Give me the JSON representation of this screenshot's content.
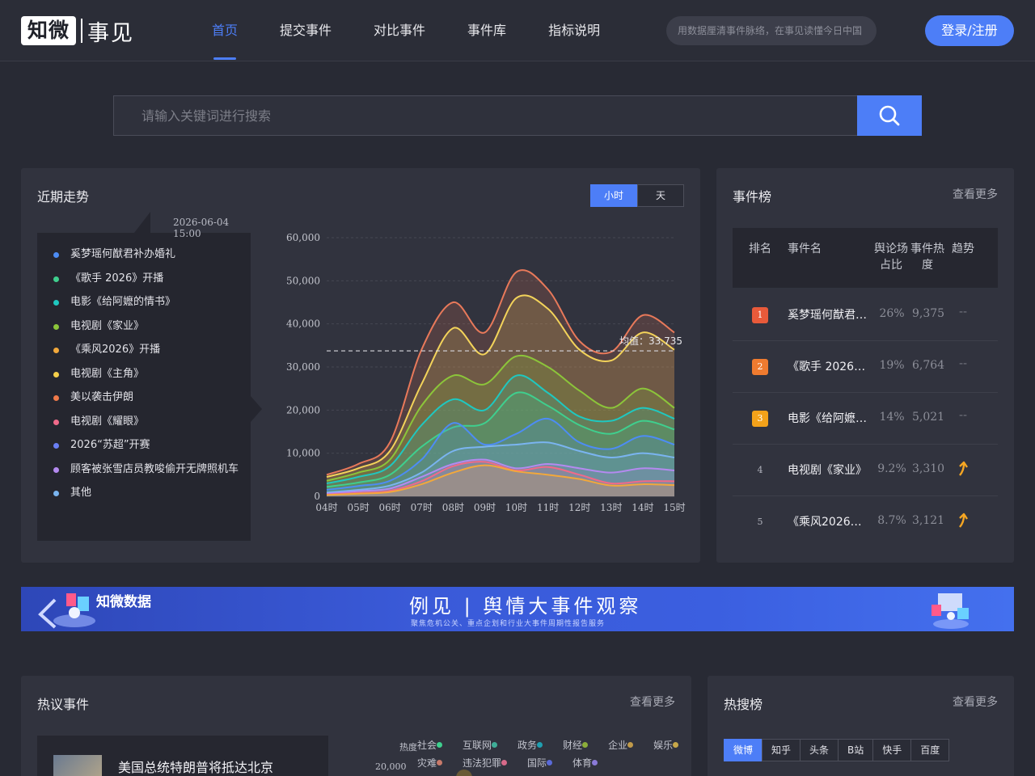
{
  "header": {
    "logo_main": "知微",
    "logo_sub": "事见",
    "nav": [
      "首页",
      "提交事件",
      "对比事件",
      "事件库",
      "指标说明"
    ],
    "search_placeholder": "用数据厘清事件脉络，在事见读懂今日中国",
    "login_label": "登录/注册"
  },
  "search": {
    "placeholder": "请输入关键词进行搜索"
  },
  "trend": {
    "title": "近期走势",
    "toggle": [
      "小时",
      "天"
    ],
    "tooltip_time": "2026-06-04 15:00",
    "tooltip_items": [
      {
        "label": "奚梦瑶何猷君补办婚礼",
        "color": "#4d8cf5"
      },
      {
        "label": "《歌手 2026》开播",
        "color": "#3fcf8e"
      },
      {
        "label": "电影《给阿嬷的情书》",
        "color": "#1fc8c0"
      },
      {
        "label": "电视剧《家业》",
        "color": "#8cc53a"
      },
      {
        "label": "《乘风2026》开播",
        "color": "#f2a83b"
      },
      {
        "label": "电视剧《主角》",
        "color": "#f5cf4a"
      },
      {
        "label": "美以袭击伊朗",
        "color": "#f07a4a"
      },
      {
        "label": "电视剧《耀眼》",
        "color": "#f06a8a"
      },
      {
        "label": "2026“苏超”开赛",
        "color": "#6a7ff5"
      },
      {
        "label": "顾客被张雪店员教唆偷开无牌照机车",
        "color": "#b48af0"
      },
      {
        "label": "其他",
        "color": "#7ab4f0"
      }
    ]
  },
  "chart_data": {
    "type": "area",
    "x": [
      "04时",
      "05时",
      "06时",
      "07时",
      "08时",
      "09时",
      "10时",
      "11时",
      "12时",
      "13时",
      "14时",
      "15时"
    ],
    "yticks": [
      "0",
      "10,000",
      "20,000",
      "30,000",
      "40,000",
      "50,000",
      "60,000"
    ],
    "ylim": [
      0,
      60000
    ],
    "mean_label": "均值：33,735",
    "mean_value": 33735,
    "series": [
      {
        "color": "#e8795a",
        "values": [
          5000,
          7500,
          12500,
          34000,
          45000,
          38000,
          52000,
          48000,
          36000,
          33500,
          42000,
          38000
        ]
      },
      {
        "color": "#f3d35a",
        "values": [
          4500,
          6500,
          10500,
          26000,
          39000,
          33000,
          46000,
          43500,
          34000,
          31500,
          38000,
          34000
        ]
      },
      {
        "color": "#8cc53a",
        "values": [
          3600,
          5500,
          8500,
          21000,
          28000,
          26000,
          32500,
          30000,
          24500,
          20500,
          25000,
          20500
        ]
      },
      {
        "color": "#1fc8c0",
        "values": [
          3000,
          4500,
          7000,
          16500,
          22500,
          20000,
          28000,
          24000,
          18500,
          17500,
          20500,
          18000
        ]
      },
      {
        "color": "#3fcf8e",
        "values": [
          2200,
          3200,
          5000,
          11500,
          16000,
          17000,
          24000,
          21000,
          16500,
          14500,
          17500,
          15500
        ]
      },
      {
        "color": "#4d8cf5",
        "values": [
          1500,
          2400,
          3600,
          8500,
          17000,
          12000,
          14500,
          18000,
          12500,
          11000,
          14000,
          12000
        ]
      },
      {
        "color": "#7ab4f0",
        "values": [
          900,
          1500,
          2500,
          5500,
          10500,
          11500,
          12000,
          12500,
          10500,
          9000,
          10000,
          9000
        ]
      },
      {
        "color": "#b48af0",
        "values": [
          600,
          1200,
          1800,
          4500,
          7500,
          8500,
          6500,
          7500,
          6500,
          5500,
          6500,
          6000
        ]
      },
      {
        "color": "#f06a8a",
        "values": [
          400,
          800,
          1300,
          3500,
          7000,
          8000,
          6000,
          6800,
          5000,
          3000,
          3500,
          3500
        ]
      },
      {
        "color": "#f2a83b",
        "values": [
          300,
          600,
          1000,
          2800,
          5500,
          7200,
          5800,
          5000,
          4000,
          2500,
          2800,
          2600
        ]
      }
    ]
  },
  "events": {
    "title": "事件榜",
    "more": "查看更多",
    "columns": [
      "排名",
      "事件名",
      "舆论场占比",
      "事件热度",
      "趋势"
    ],
    "rows": [
      {
        "rank": "1",
        "name": "奚梦瑶何猷君补办婚礼",
        "share": "26%",
        "heat": "9,375",
        "trend": "--",
        "badge": "#e85a3a"
      },
      {
        "rank": "2",
        "name": "《歌手 2026》开播",
        "share": "19%",
        "heat": "6,764",
        "trend": "--",
        "badge": "#ef7b2f"
      },
      {
        "rank": "3",
        "name": "电影《给阿嬷的情书》",
        "share": "14%",
        "heat": "5,021",
        "trend": "--",
        "badge": "#f3a21a"
      },
      {
        "rank": "4",
        "name": "电视剧《家业》",
        "share": "9.2%",
        "heat": "3,310",
        "trend": "up",
        "badge": ""
      },
      {
        "rank": "5",
        "name": "《乘风2026》开播",
        "share": "8.7%",
        "heat": "3,121",
        "trend": "up",
        "badge": ""
      }
    ]
  },
  "banner": {
    "brand": "知微数据",
    "title": "例见 | 舆情大事件观察",
    "subtitle": "聚焦危机公关、重点企划和行业大事件周期性报告服务"
  },
  "hot": {
    "title": "热议事件",
    "more": "查看更多",
    "card_title": "美国总统特朗普将抵达北京",
    "axis_label": "热度",
    "axis_value": "20,000",
    "legend": [
      {
        "label": "社会",
        "color": "#3fcf8e"
      },
      {
        "label": "互联网",
        "color": "#3fae98"
      },
      {
        "label": "政务",
        "color": "#1f9fb0"
      },
      {
        "label": "财经",
        "color": "#8cae3a"
      },
      {
        "label": "企业",
        "color": "#c09a4a"
      },
      {
        "label": "娱乐",
        "color": "#c8a84a"
      },
      {
        "label": "灾难",
        "color": "#c87a6a"
      },
      {
        "label": "违法犯罪",
        "color": "#d86a8a"
      },
      {
        "label": "国际",
        "color": "#5a6ad8"
      },
      {
        "label": "体育",
        "color": "#8a7ad8"
      }
    ]
  },
  "searchrank": {
    "title": "热搜榜",
    "more": "查看更多",
    "tabs": [
      "微博",
      "知乎",
      "头条",
      "B站",
      "快手",
      "百度"
    ]
  }
}
